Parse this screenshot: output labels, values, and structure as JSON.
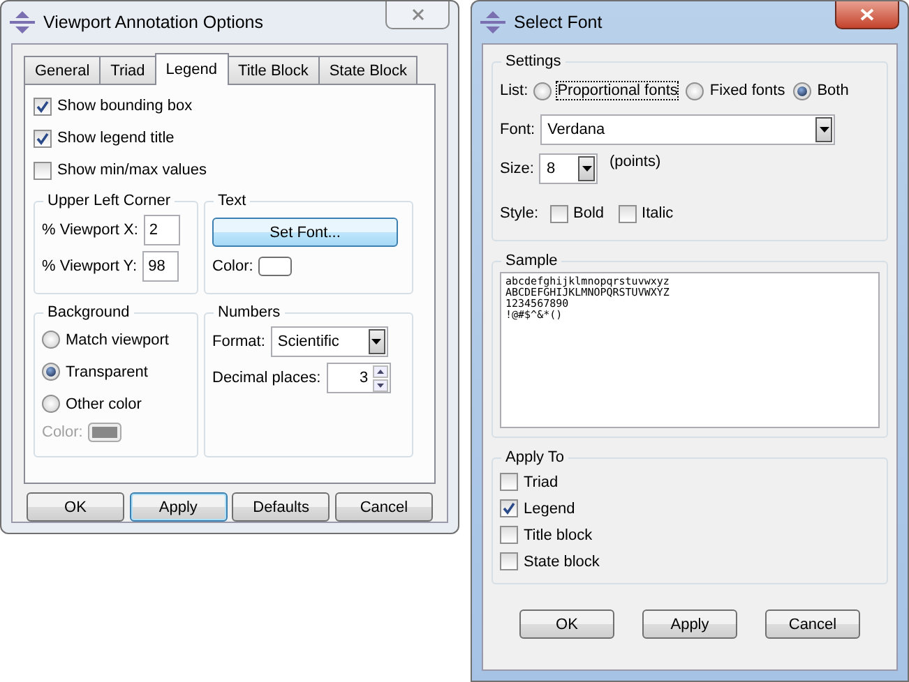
{
  "annotation_window": {
    "title": "Viewport Annotation Options",
    "tabs": [
      {
        "label": "General",
        "selected": false
      },
      {
        "label": "Triad",
        "selected": false
      },
      {
        "label": "Legend",
        "selected": true
      },
      {
        "label": "Title Block",
        "selected": false
      },
      {
        "label": "State Block",
        "selected": false
      }
    ],
    "checkboxes": [
      {
        "label": "Show bounding box",
        "checked": true
      },
      {
        "label": "Show legend title",
        "checked": true
      },
      {
        "label": "Show min/max values",
        "checked": false
      }
    ],
    "upper_left_corner": {
      "title": "Upper Left Corner",
      "fields": [
        {
          "label": "% Viewport X:",
          "value": "2"
        },
        {
          "label": "% Viewport Y:",
          "value": "98"
        }
      ]
    },
    "text": {
      "title": "Text",
      "button": "Set Font...",
      "color_label": "Color:"
    },
    "background": {
      "title": "Background",
      "radios": [
        {
          "label": "Match viewport",
          "selected": false
        },
        {
          "label": "Transparent",
          "selected": true
        },
        {
          "label": "Other color",
          "selected": false
        }
      ],
      "color_label": "Color:",
      "color_disabled": true
    },
    "numbers": {
      "title": "Numbers",
      "format_label": "Format:",
      "format_value": "Scientific",
      "decimal_label": "Decimal places:",
      "decimal_value": "3"
    },
    "buttons": [
      {
        "label": "OK",
        "focused": false
      },
      {
        "label": "Apply",
        "focused": true
      },
      {
        "label": "Defaults",
        "focused": false
      },
      {
        "label": "Cancel",
        "focused": false
      }
    ]
  },
  "font_window": {
    "title": "Select Font",
    "settings": {
      "title": "Settings",
      "list_label": "List:",
      "list_options": [
        {
          "label": "Proportional fonts",
          "selected": false,
          "focused": true
        },
        {
          "label": "Fixed fonts",
          "selected": false,
          "focused": false
        },
        {
          "label": "Both",
          "selected": true,
          "focused": false
        }
      ],
      "font_label": "Font:",
      "font_value": "Verdana",
      "size_label": "Size:",
      "size_value": "8",
      "size_unit": "(points)",
      "style_label": "Style:",
      "styles": [
        {
          "label": "Bold",
          "checked": false
        },
        {
          "label": "Italic",
          "checked": false
        }
      ]
    },
    "sample": {
      "title": "Sample",
      "lines": [
        "abcdefghijklmnopqrstuvwxyz",
        "ABCDEFGHIJKLMNOPQRSTUVWXYZ",
        "1234567890",
        "!@#$^&*()"
      ]
    },
    "apply_to": {
      "title": "Apply To",
      "items": [
        {
          "label": "Triad",
          "checked": false
        },
        {
          "label": "Legend",
          "checked": true
        },
        {
          "label": "Title block",
          "checked": false
        },
        {
          "label": "State block",
          "checked": false
        }
      ]
    },
    "buttons": [
      {
        "label": "OK",
        "focused": false
      },
      {
        "label": "Apply",
        "focused": false
      },
      {
        "label": "Cancel",
        "focused": false
      }
    ]
  }
}
